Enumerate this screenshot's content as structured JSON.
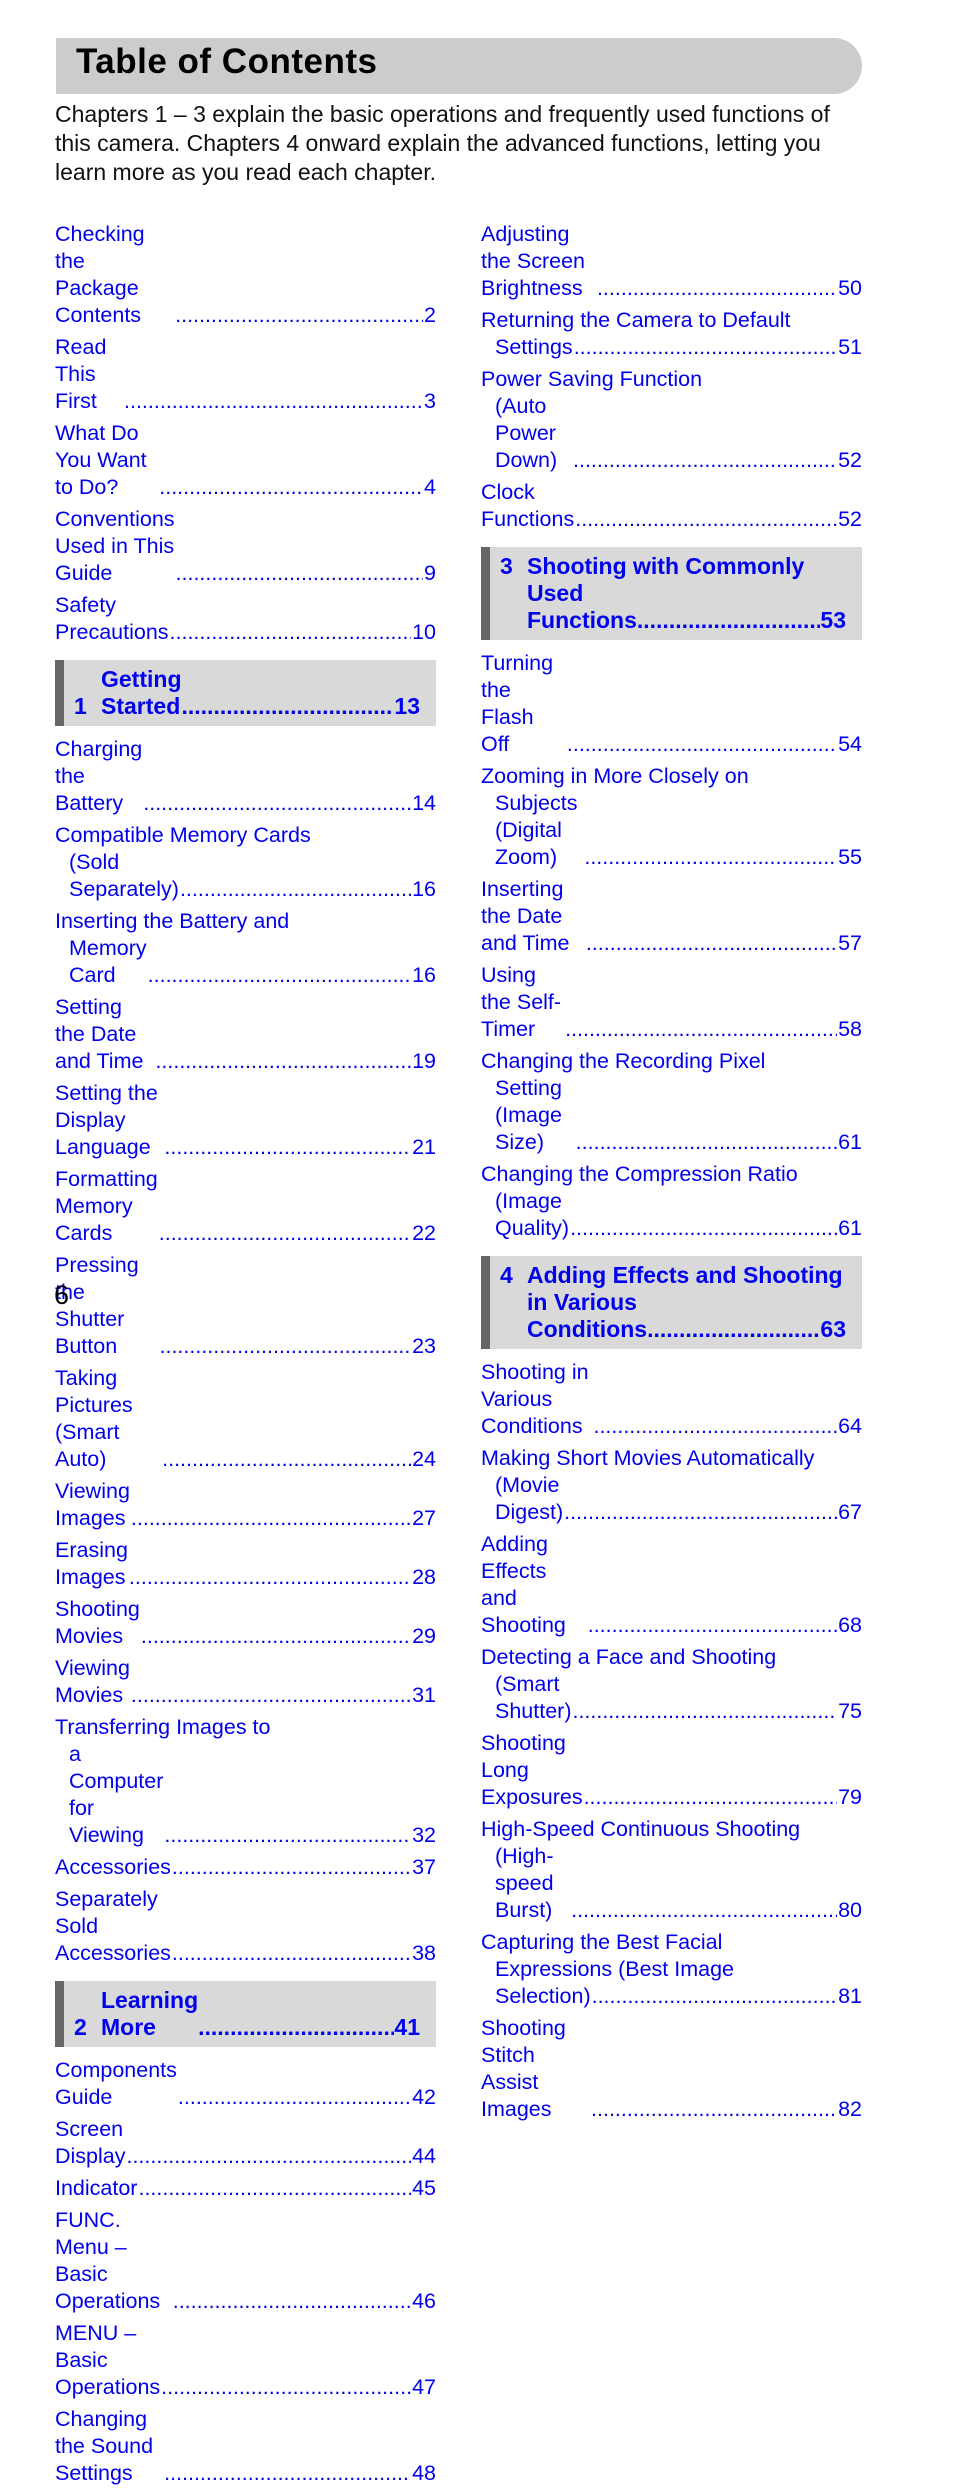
{
  "header": {
    "title": "Table of Contents"
  },
  "intro": "Chapters 1 – 3 explain the basic operations and frequently used functions of this camera. Chapters 4 onward explain the advanced functions, letting you learn more as you read each chapter.",
  "colors": {
    "link": "#0000ee",
    "band": "#cccccc",
    "chapter_bg": "#d9d9d9",
    "chapter_bar": "#666666"
  },
  "left": {
    "front": [
      {
        "label": "Checking the Package Contents",
        "page": "2"
      },
      {
        "label": "Read This First",
        "page": "3"
      },
      {
        "label": "What Do You Want to Do?",
        "page": "4"
      },
      {
        "label": "Conventions Used in This Guide",
        "page": "9"
      },
      {
        "label": "Safety Precautions",
        "page": "10"
      }
    ],
    "ch1": {
      "number": "1",
      "title": "Getting Started",
      "page": "13",
      "items": [
        {
          "label": "Charging the Battery",
          "page": "14"
        },
        {
          "line1": "Compatible Memory Cards",
          "line2": "(Sold Separately)",
          "page": "16"
        },
        {
          "line1": "Inserting the Battery and",
          "line2": "Memory Card",
          "page": "16"
        },
        {
          "label": "Setting the Date and Time",
          "page": "19"
        },
        {
          "label": "Setting the Display Language",
          "page": "21"
        },
        {
          "label": "Formatting Memory Cards",
          "page": "22"
        },
        {
          "label": "Pressing the Shutter Button",
          "page": "23"
        },
        {
          "label": "Taking Pictures (Smart Auto)",
          "page": "24"
        },
        {
          "label": "Viewing Images",
          "page": "27"
        },
        {
          "label": "Erasing Images",
          "page": "28"
        },
        {
          "label": "Shooting Movies",
          "page": "29"
        },
        {
          "label": "Viewing Movies",
          "page": "31"
        },
        {
          "line1": "Transferring Images to",
          "line2": "a Computer for Viewing",
          "page": "32"
        },
        {
          "label": "Accessories",
          "page": "37"
        },
        {
          "label": "Separately Sold Accessories",
          "page": "38"
        }
      ]
    },
    "ch2": {
      "number": "2",
      "title": "Learning More",
      "page": "41",
      "items": [
        {
          "label": "Components Guide",
          "page": "42"
        },
        {
          "label": "Screen Display",
          "page": "44"
        },
        {
          "label": "Indicator",
          "page": "45"
        },
        {
          "label": "FUNC. Menu – Basic Operations",
          "page": "46"
        },
        {
          "label": "MENU – Basic Operations",
          "page": "47"
        },
        {
          "label": "Changing the Sound Settings",
          "page": "48"
        }
      ]
    }
  },
  "right": {
    "front": [
      {
        "label": "Adjusting the Screen Brightness",
        "page": "50"
      },
      {
        "line1": "Returning the Camera to Default",
        "line2": "Settings",
        "page": "51"
      },
      {
        "line1": "Power Saving Function",
        "line2": "(Auto Power Down)",
        "page": "52"
      },
      {
        "label": "Clock Functions",
        "page": "52"
      }
    ],
    "ch3": {
      "number": "3",
      "title_line1": "Shooting with Commonly",
      "title_line2": "Used Functions",
      "page": "53",
      "items": [
        {
          "label": "Turning the Flash Off",
          "page": "54"
        },
        {
          "line1": "Zooming in More Closely on",
          "line2": "Subjects (Digital Zoom)",
          "page": "55"
        },
        {
          "label": "Inserting the Date and Time",
          "page": "57"
        },
        {
          "label": "Using the Self-Timer",
          "page": "58"
        },
        {
          "line1": "Changing the Recording Pixel",
          "line2": "Setting (Image Size)",
          "page": "61"
        },
        {
          "line1": "Changing the Compression Ratio",
          "line2": "(Image Quality)",
          "page": "61"
        }
      ]
    },
    "ch4": {
      "number": "4",
      "title_line1": "Adding Effects and Shooting",
      "title_line2": "in Various Conditions",
      "page": "63",
      "items": [
        {
          "label": "Shooting in Various Conditions",
          "page": "64"
        },
        {
          "line1": "Making Short Movies Automatically",
          "line2": "(Movie Digest)",
          "page": "67"
        },
        {
          "label": "Adding Effects and Shooting",
          "page": "68"
        },
        {
          "line1": "Detecting a Face and Shooting",
          "line2": "(Smart Shutter)",
          "page": "75"
        },
        {
          "label": "Shooting Long Exposures",
          "page": "79"
        },
        {
          "line1": "High-Speed Continuous Shooting",
          "line2": "(High-speed Burst)",
          "page": "80"
        },
        {
          "line1": "Capturing the Best Facial",
          "line2": "Expressions (Best Image",
          "line3": "Selection)",
          "page": "81"
        },
        {
          "label": "Shooting Stitch Assist Images",
          "page": "82"
        }
      ]
    }
  },
  "footer": {
    "page_number": "6"
  }
}
